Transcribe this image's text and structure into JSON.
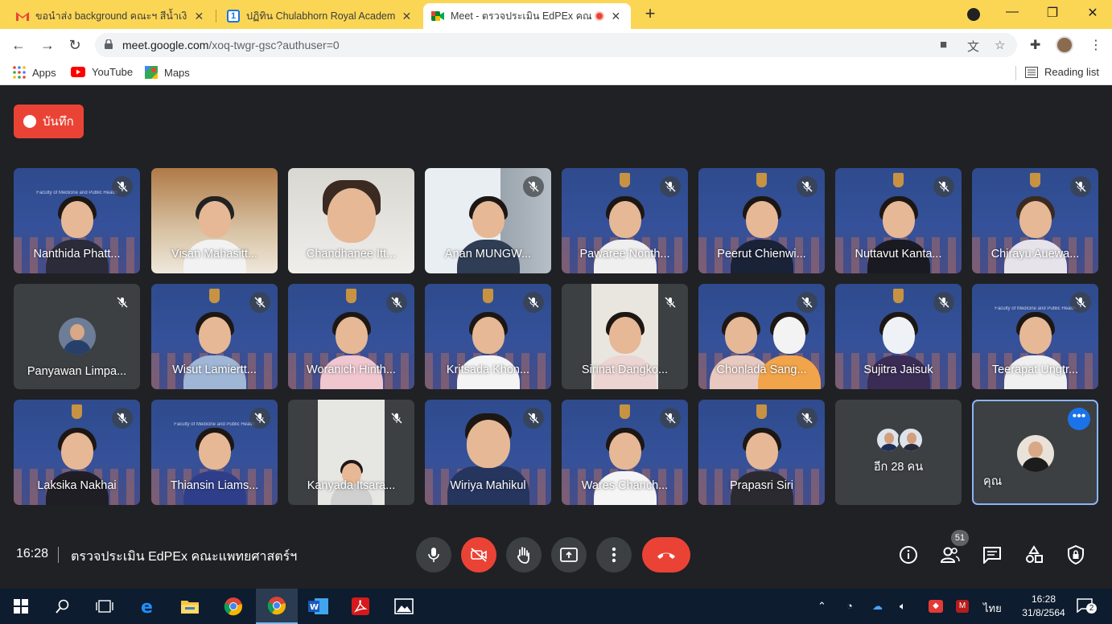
{
  "browser": {
    "tabs": [
      {
        "title": "ขอนำส่ง background คณะฯ สีน้ำเงิน",
        "icon": "gmail-icon"
      },
      {
        "title": "ปฏิทิน Chulabhorn Royal Academy",
        "icon": "calendar-icon",
        "icon_text": "1"
      },
      {
        "title": "Meet - ตรวจประเมิน EdPEx คณะ",
        "icon": "meet-icon"
      }
    ],
    "url_host": "meet.google.com",
    "url_path": "/xoq-twgr-gsc?authuser=0",
    "bookmarks": [
      "Apps",
      "YouTube",
      "Maps"
    ],
    "reading_list": "Reading list"
  },
  "meet": {
    "record_label": "บันทึก",
    "participants": [
      {
        "name": "Nanthida Phatt...",
        "muted": true
      },
      {
        "name": "Visan Mahasitt...",
        "muted": false
      },
      {
        "name": "Chandhanee Itt...",
        "muted": false
      },
      {
        "name": "Anan MUNGW...",
        "muted": true
      },
      {
        "name": "Pawaree Nonth...",
        "muted": true
      },
      {
        "name": "Peerut Chienwi...",
        "muted": true
      },
      {
        "name": "Nuttavut Kanta...",
        "muted": true
      },
      {
        "name": "Chirayu Auewa...",
        "muted": true
      },
      {
        "name": "Panyawan Limpa...",
        "muted": true
      },
      {
        "name": "Wisut Lamiertt...",
        "muted": true
      },
      {
        "name": "Woranich Hinth...",
        "muted": true
      },
      {
        "name": "Kritsada Khon...",
        "muted": true
      },
      {
        "name": "Sirinat Dangko...",
        "muted": true
      },
      {
        "name": "Chonlada Sang...",
        "muted": true
      },
      {
        "name": "Sujitra Jaisuk",
        "muted": true
      },
      {
        "name": "Teerapat Ungtr...",
        "muted": true
      },
      {
        "name": "Laksika Nakhai",
        "muted": true
      },
      {
        "name": "Thiansin Liams...",
        "muted": true
      },
      {
        "name": "Kanyada Itsara...",
        "muted": true
      },
      {
        "name": "Wiriya Mahikul",
        "muted": true
      },
      {
        "name": "Wares Chanch...",
        "muted": true
      },
      {
        "name": "Prapasri Siri",
        "muted": true
      }
    ],
    "more_label": "อีก 28 คน",
    "self_label": "คุณ",
    "time": "16:28",
    "meeting_title": "ตรวจประเมิน EdPEx คณะแพทยศาสตร์ฯ",
    "people_count": "51"
  },
  "taskbar": {
    "language": "ไทย",
    "time": "16:28",
    "date": "31/8/2564",
    "notifications": "2"
  },
  "colors": {
    "tab_strip": "#fbd655",
    "meet_bg": "#202124",
    "tile_blue": "#2f4b8d",
    "danger": "#ea4335",
    "self_border": "#8ab4f8"
  }
}
